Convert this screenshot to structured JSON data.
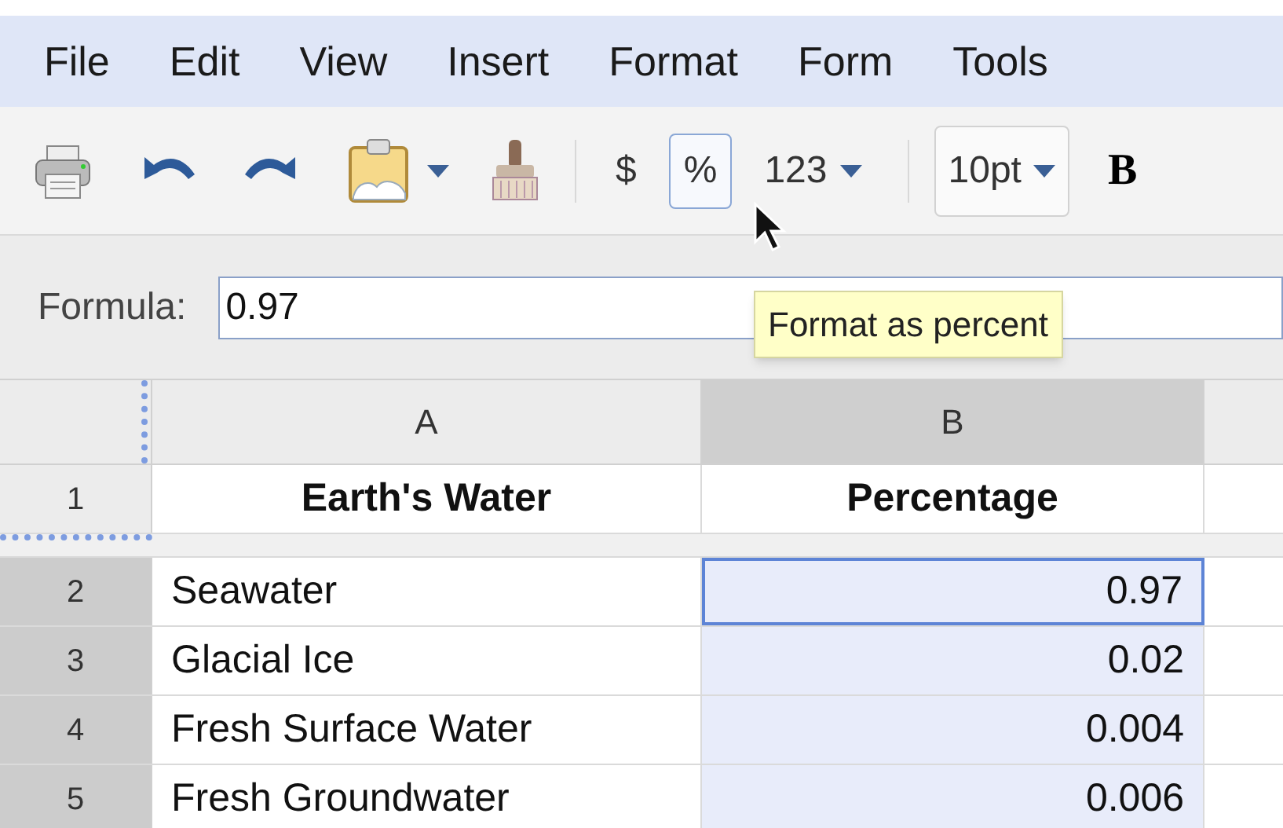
{
  "menu": [
    "File",
    "Edit",
    "View",
    "Insert",
    "Format",
    "Form",
    "Tools"
  ],
  "toolbar": [
    {
      "kind": "print"
    },
    {
      "kind": "undo"
    },
    {
      "kind": "redo"
    },
    {
      "kind": "image-menu"
    },
    {
      "kind": "paint"
    },
    {
      "kind": "separator"
    },
    {
      "kind": "text",
      "text": "$",
      "highlighted": false
    },
    {
      "kind": "text",
      "text": "%",
      "highlighted": true
    },
    {
      "kind": "dropdown",
      "text": "123",
      "boxed": false
    },
    {
      "kind": "separator"
    },
    {
      "kind": "dropdown",
      "text": "10pt",
      "boxed": true
    },
    {
      "kind": "bold",
      "text": "B"
    }
  ],
  "formula": {
    "label": "Formula:",
    "value": "0.97"
  },
  "tooltip": "Format as percent",
  "columns": [
    {
      "label": "A",
      "selected": false
    },
    {
      "label": "B",
      "selected": true
    }
  ],
  "rows": [
    {
      "number": "1",
      "kind": "header",
      "selected": false,
      "cells": [
        {
          "text": "Earth's Water",
          "selected": false,
          "active": false
        },
        {
          "text": "Percentage",
          "selected": false,
          "active": false
        }
      ]
    },
    {
      "number": "2",
      "kind": "data",
      "selected": true,
      "cells": [
        {
          "text": "Seawater",
          "selected": false,
          "active": false
        },
        {
          "text": "0.97",
          "selected": true,
          "active": true
        }
      ]
    },
    {
      "number": "3",
      "kind": "data",
      "selected": true,
      "cells": [
        {
          "text": "Glacial Ice",
          "selected": false,
          "active": false
        },
        {
          "text": "0.02",
          "selected": true,
          "active": false
        }
      ]
    },
    {
      "number": "4",
      "kind": "data",
      "selected": true,
      "cells": [
        {
          "text": "Fresh Surface Water",
          "selected": false,
          "active": false
        },
        {
          "text": "0.004",
          "selected": true,
          "active": false
        }
      ]
    },
    {
      "number": "5",
      "kind": "data",
      "selected": true,
      "cells": [
        {
          "text": "Fresh Groundwater",
          "selected": false,
          "active": false
        },
        {
          "text": "0.006",
          "selected": true,
          "active": false
        }
      ]
    }
  ]
}
